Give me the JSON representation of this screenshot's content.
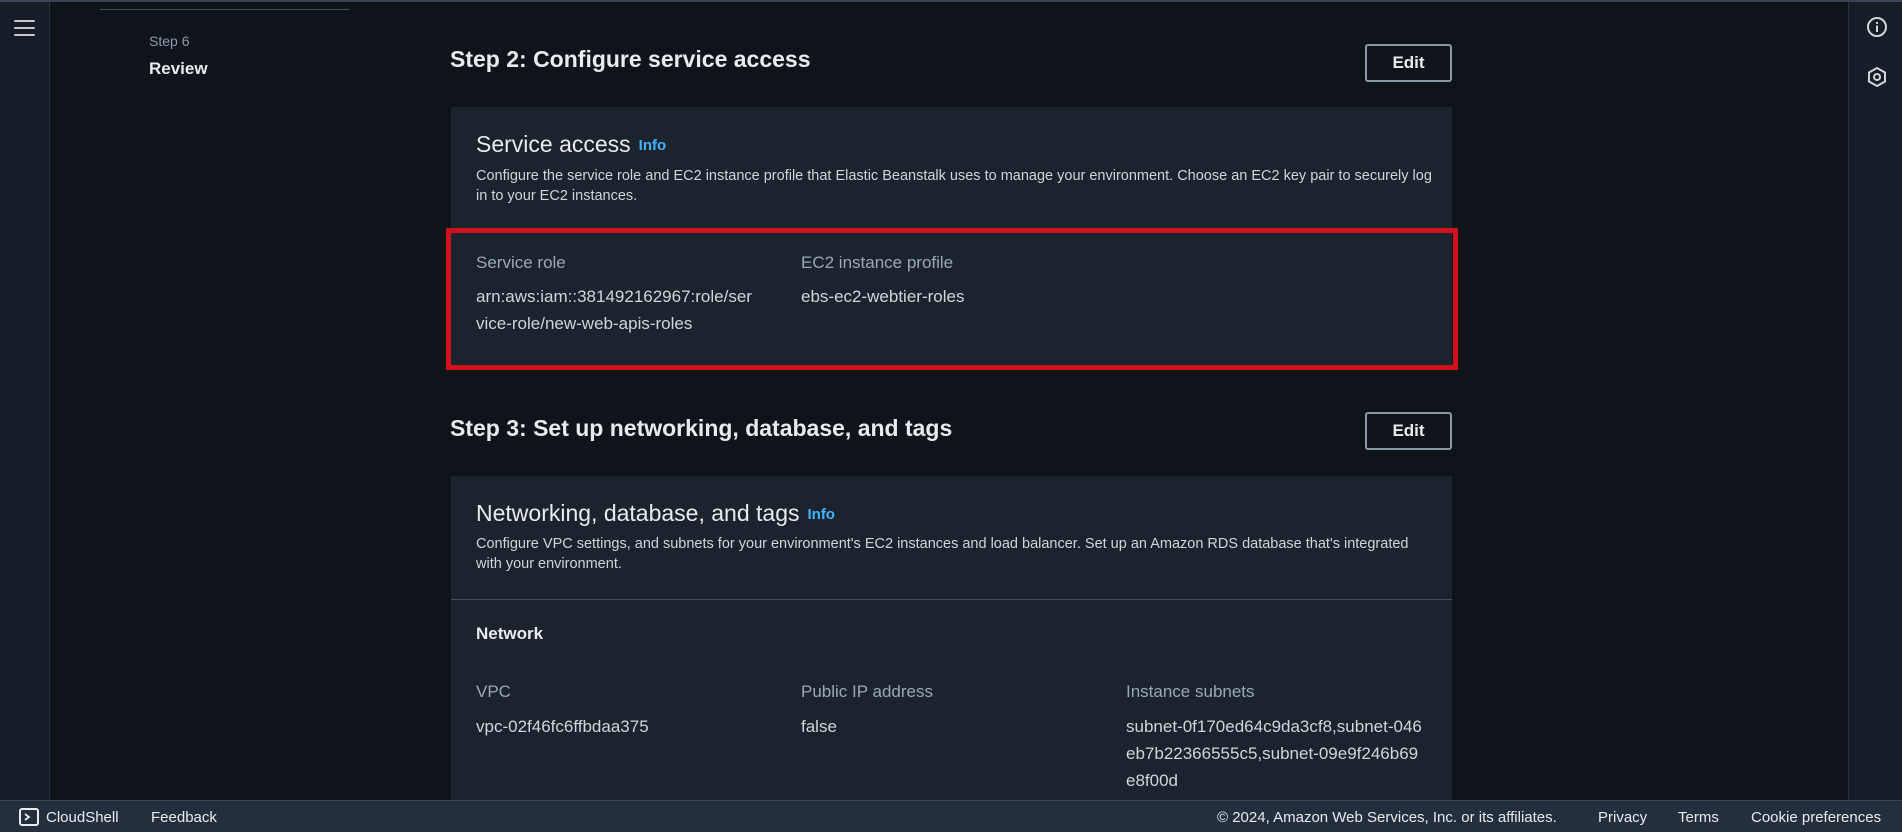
{
  "side_nav": {
    "step_label": "Step 6",
    "step_title": "Review"
  },
  "step2": {
    "heading": "Step 2: Configure service access",
    "edit_label": "Edit",
    "panel": {
      "title": "Service access",
      "info": "Info",
      "description": "Configure the service role and EC2 instance profile that Elastic Beanstalk uses to manage your environment. Choose an EC2 key pair to securely log in to your EC2 instances.",
      "fields": [
        {
          "label": "Service role",
          "value": "arn:aws:iam::381492162967:role/ser vice-role/new-web-apis-roles"
        },
        {
          "label": "EC2 instance profile",
          "value": "ebs-ec2-webtier-roles"
        }
      ]
    }
  },
  "step3": {
    "heading": "Step 3: Set up networking, database, and tags",
    "edit_label": "Edit",
    "panel": {
      "title": "Networking, database, and tags",
      "info": "Info",
      "description": "Configure VPC settings, and subnets for your environment's EC2 instances and load balancer. Set up an Amazon RDS database that's integrated with your environment.",
      "section": "Network",
      "fields": [
        {
          "label": "VPC",
          "value": "vpc-02f46fc6ffbdaa375"
        },
        {
          "label": "Public IP address",
          "value": "false"
        },
        {
          "label": "Instance subnets",
          "value": "subnet-0f170ed64c9da3cf8,subnet-046eb7b22366555c5,subnet-09e9f246b69e8f00d"
        }
      ]
    }
  },
  "footer": {
    "cloudshell": "CloudShell",
    "feedback": "Feedback",
    "copyright": "© 2024, Amazon Web Services, Inc. or its affiliates.",
    "privacy": "Privacy",
    "terms": "Terms",
    "cookies": "Cookie preferences"
  },
  "colors": {
    "accent_link": "#42b4ff",
    "highlight_border": "#d1111c",
    "panel_bg": "#1b232d",
    "page_bg": "#0f141a"
  },
  "icons": [
    "menu-icon",
    "info-circle-icon",
    "settings-hex-icon",
    "cloudshell-icon"
  ]
}
